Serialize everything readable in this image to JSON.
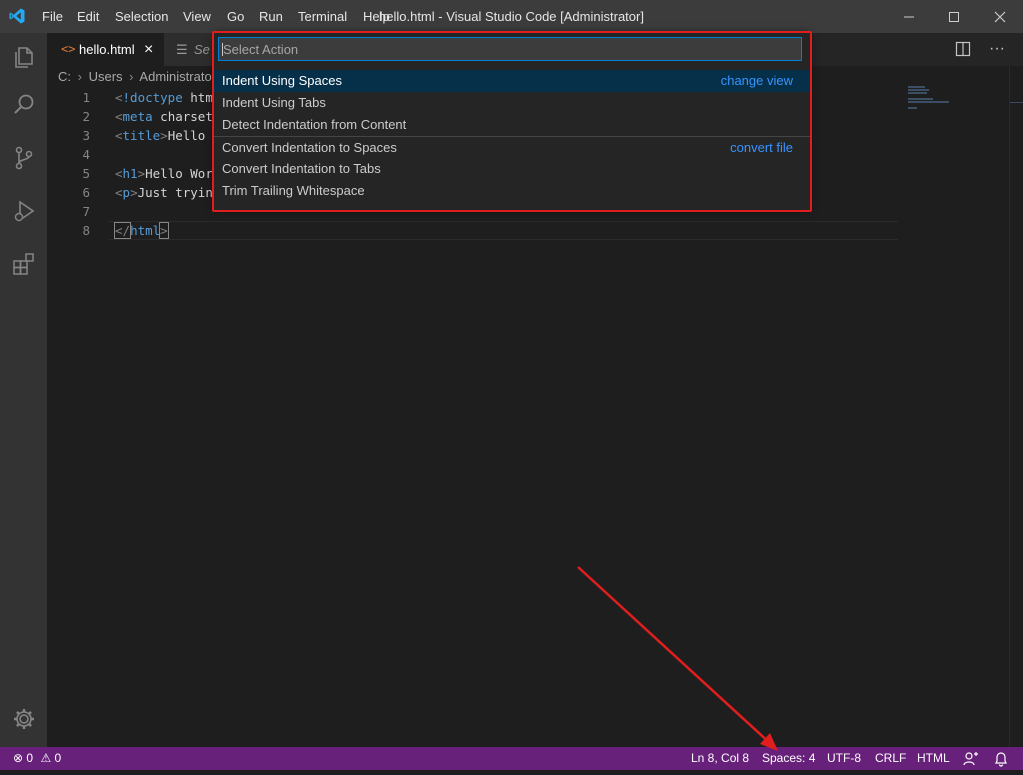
{
  "titlebar": {
    "menu": [
      "File",
      "Edit",
      "Selection",
      "View",
      "Go",
      "Run",
      "Terminal",
      "Help"
    ],
    "title": "hello.html - Visual Studio Code [Administrator]"
  },
  "tabs": [
    {
      "label": "hello.html",
      "icon": "html-file-icon",
      "close": "×"
    },
    {
      "label": "Se",
      "icon": "settings-file-icon"
    }
  ],
  "breadcrumb": {
    "parts": [
      "C:",
      "Users",
      "Administrato"
    ]
  },
  "editor": {
    "line_numbers": [
      "1",
      "2",
      "3",
      "4",
      "5",
      "6",
      "7",
      "8"
    ],
    "lines": [
      {
        "open": "<",
        "tag": "!doctype",
        "rest": " htm"
      },
      {
        "open": "<",
        "tag": "meta",
        "rest": " charset"
      },
      {
        "open": "<",
        "tag": "title",
        "close": ">",
        "rest": "Hello"
      },
      {},
      {
        "open": "<",
        "tag": "h1",
        "close": ">",
        "rest": "Hello Wor"
      },
      {
        "open": "<",
        "tag": "p",
        "close": ">",
        "rest": "Just tryin"
      },
      {},
      {
        "open": "</",
        "tag": "html",
        "close": ">"
      }
    ]
  },
  "quickpick": {
    "placeholder": "Select Action",
    "items": [
      {
        "label": "Indent Using Spaces",
        "side": "change view"
      },
      {
        "label": "Indent Using Tabs"
      },
      {
        "label": "Detect Indentation from Content"
      },
      {
        "label": "Convert Indentation to Spaces",
        "side": "convert file"
      },
      {
        "label": "Convert Indentation to Tabs"
      },
      {
        "label": "Trim Trailing Whitespace"
      }
    ]
  },
  "statusbar": {
    "errors": "0",
    "warnings": "0",
    "position": "Ln 8, Col 8",
    "indent": "Spaces: 4",
    "encoding": "UTF-8",
    "eol": "CRLF",
    "language": "HTML"
  },
  "colors": {
    "statusbar": "#68217a",
    "accent": "#3794ff",
    "highlight": "#e01e1e"
  }
}
